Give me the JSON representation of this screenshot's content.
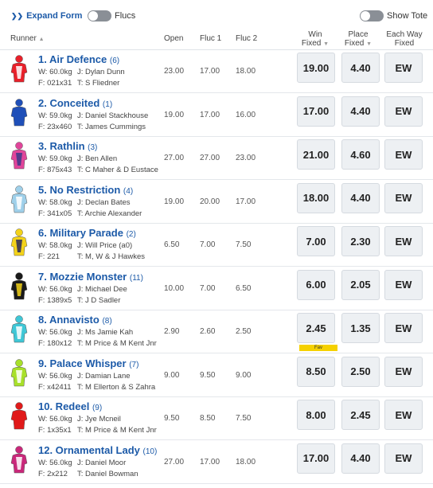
{
  "top": {
    "expand_label": "Expand Form",
    "flucs_label": "Flucs",
    "tote_label": "Show Tote"
  },
  "header": {
    "runner": "Runner",
    "open": "Open",
    "fluc1": "Fluc 1",
    "fluc2": "Fluc 2",
    "win_line1": "Win",
    "win_line2": "Fixed",
    "place_line1": "Place",
    "place_line2": "Fixed",
    "ew_line1": "Each Way",
    "ew_line2": "Fixed"
  },
  "runners": [
    {
      "name": "1. Air Defence",
      "barrier": "(6)",
      "weight": "W: 60.0kg",
      "jockey": "J: Dylan Dunn",
      "form": "F: 021x31",
      "trainer": "T: S Fliedner",
      "open": "23.00",
      "fluc1": "17.00",
      "fluc2": "18.00",
      "win": "19.00",
      "place": "4.40",
      "ew": "EW",
      "silk_colors": [
        "#e8202a",
        "#ffffff"
      ]
    },
    {
      "name": "2. Conceited",
      "barrier": "(1)",
      "weight": "W: 59.0kg",
      "jockey": "J: Daniel Stackhouse",
      "form": "F: 23x460",
      "trainer": "T: James Cummings",
      "open": "19.00",
      "fluc1": "17.00",
      "fluc2": "16.00",
      "win": "17.00",
      "place": "4.40",
      "ew": "EW",
      "silk_colors": [
        "#1f4fb8",
        "#1f4fb8"
      ]
    },
    {
      "name": "3. Rathlin",
      "barrier": "(3)",
      "weight": "W: 59.0kg",
      "jockey": "J: Ben Allen",
      "form": "F: 875x43",
      "trainer": "T: C Maher & D Eustace",
      "open": "27.00",
      "fluc1": "27.00",
      "fluc2": "23.00",
      "win": "21.00",
      "place": "4.60",
      "ew": "EW",
      "silk_colors": [
        "#e0459a",
        "#3a3a8a"
      ]
    },
    {
      "name": "5. No Restriction",
      "barrier": "(4)",
      "weight": "W: 58.0kg",
      "jockey": "J: Declan Bates",
      "form": "F: 341x05",
      "trainer": "T: Archie Alexander",
      "open": "19.00",
      "fluc1": "20.00",
      "fluc2": "17.00",
      "win": "18.00",
      "place": "4.40",
      "ew": "EW",
      "silk_colors": [
        "#9fd0ea",
        "#ffffff"
      ]
    },
    {
      "name": "6. Military Parade",
      "barrier": "(2)",
      "weight": "W: 58.0kg",
      "jockey": "J: Will Price (a0)",
      "form": "F: 221",
      "trainer": "T: M, W & J Hawkes",
      "open": "6.50",
      "fluc1": "7.00",
      "fluc2": "7.50",
      "win": "7.00",
      "place": "2.30",
      "ew": "EW",
      "silk_colors": [
        "#f3d21a",
        "#2a2a5a"
      ]
    },
    {
      "name": "7. Mozzie Monster",
      "barrier": "(11)",
      "weight": "W: 56.0kg",
      "jockey": "J: Michael Dee",
      "form": "F: 1389x5",
      "trainer": "T: J D Sadler",
      "open": "10.00",
      "fluc1": "7.00",
      "fluc2": "6.50",
      "win": "6.00",
      "place": "2.05",
      "ew": "EW",
      "silk_colors": [
        "#1a1a1a",
        "#f3d21a"
      ]
    },
    {
      "name": "8. Annavisto",
      "barrier": "(8)",
      "weight": "W: 56.0kg",
      "jockey": "J: Ms Jamie Kah",
      "form": "F: 180x12",
      "trainer": "T: M Price & M Kent Jnr",
      "open": "2.90",
      "fluc1": "2.60",
      "fluc2": "2.50",
      "win": "2.45",
      "place": "1.35",
      "ew": "EW",
      "fav": "Fav",
      "silk_colors": [
        "#3fc7d6",
        "#ffffff"
      ]
    },
    {
      "name": "9. Palace Whisper",
      "barrier": "(7)",
      "weight": "W: 56.0kg",
      "jockey": "J: Damian Lane",
      "form": "F: x42411",
      "trainer": "T: M Ellerton & S Zahra",
      "open": "9.00",
      "fluc1": "9.50",
      "fluc2": "9.00",
      "win": "8.50",
      "place": "2.50",
      "ew": "EW",
      "silk_colors": [
        "#a8e02a",
        "#ffffff"
      ]
    },
    {
      "name": "10. Redeel",
      "barrier": "(9)",
      "weight": "W: 56.0kg",
      "jockey": "J: Jye Mcneil",
      "form": "F: 1x35x1",
      "trainer": "T: M Price & M Kent Jnr",
      "open": "9.50",
      "fluc1": "8.50",
      "fluc2": "7.50",
      "win": "8.00",
      "place": "2.45",
      "ew": "EW",
      "silk_colors": [
        "#e01a1a",
        "#e01a1a"
      ]
    },
    {
      "name": "12. Ornamental Lady",
      "barrier": "(10)",
      "weight": "W: 56.0kg",
      "jockey": "J: Daniel Moor",
      "form": "F: 2x212",
      "trainer": "T: Daniel Bowman",
      "open": "27.00",
      "fluc1": "17.00",
      "fluc2": "18.00",
      "win": "17.00",
      "place": "4.40",
      "ew": "EW",
      "silk_colors": [
        "#c9287a",
        "#ffffff"
      ]
    }
  ]
}
